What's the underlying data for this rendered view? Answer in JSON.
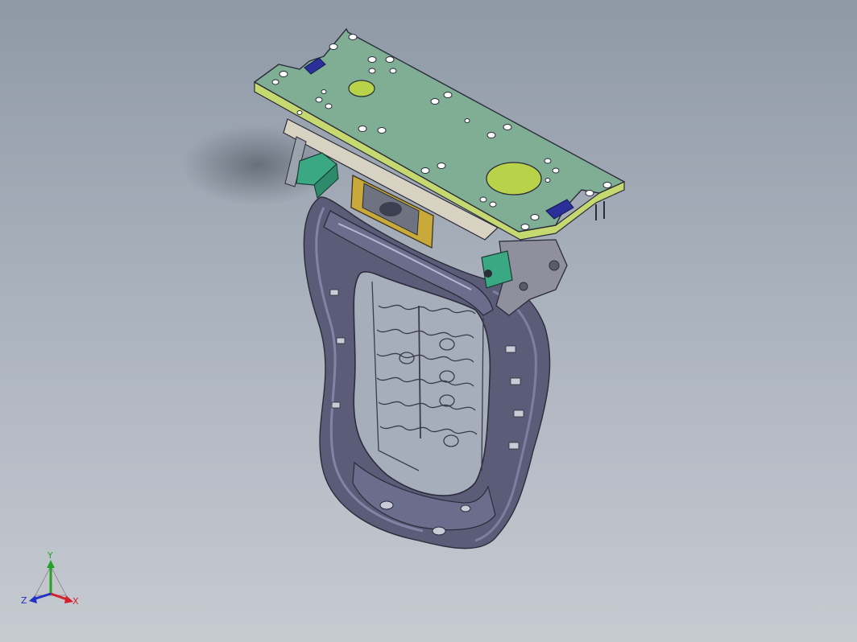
{
  "viewport": {
    "background_top": "#8f99a6",
    "background_bottom": "#c6cad1"
  },
  "model": {
    "frame_color": "#5b5c78",
    "plate_color": "#7fae95",
    "plate_edge_color": "#c6d870",
    "cutout_color": "#b8d24a",
    "block_color": "#3aa883",
    "bracket_color": "#c8a93a",
    "tab_color": "#2a2f9a"
  },
  "triad": {
    "x_label": "X",
    "y_label": "Y",
    "z_label": "Z",
    "x_color": "#d3202a",
    "y_color": "#22a32a",
    "z_color": "#2230c8"
  }
}
